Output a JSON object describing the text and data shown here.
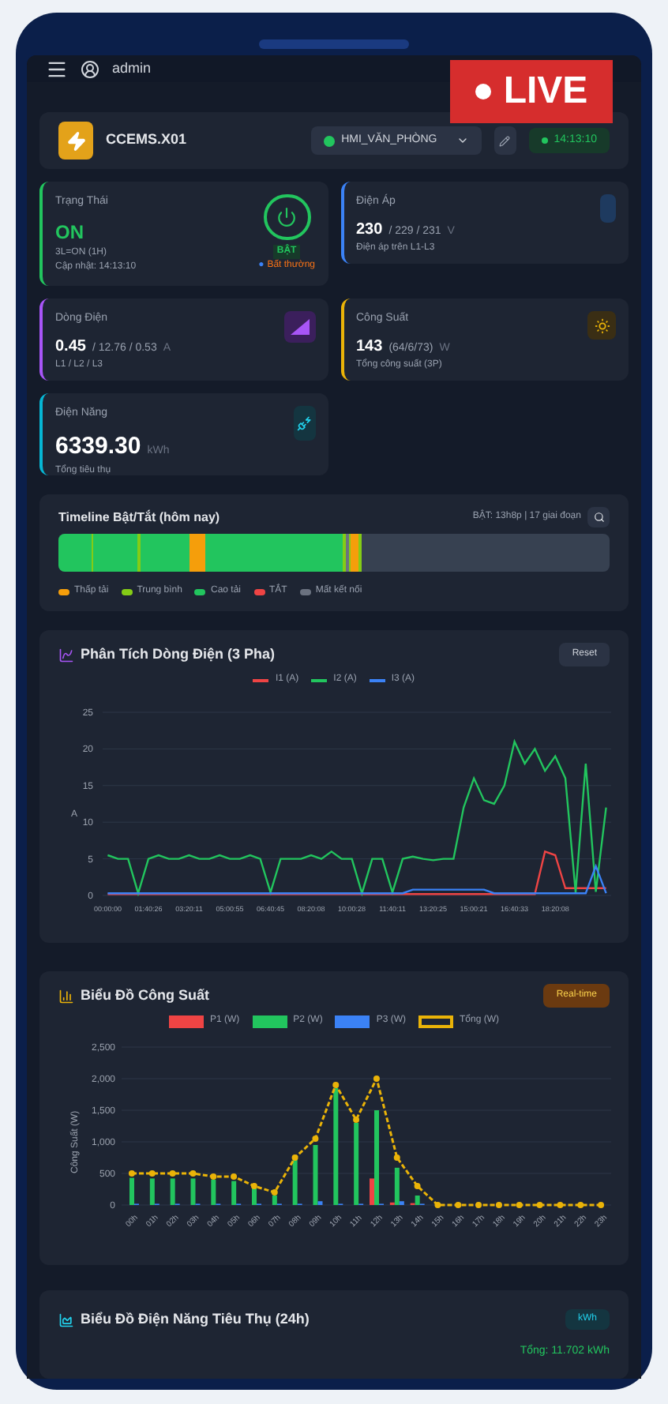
{
  "header": {
    "user": "admin"
  },
  "live_badge": {
    "label": "LIVE"
  },
  "device": {
    "name": "CCEMS.X01",
    "location": "HMI_VĂN_PHÒNG",
    "online": true,
    "time": "14:13:10"
  },
  "cards": [
    {
      "kind": "status",
      "title": "Trạng Thái",
      "value": "ON",
      "on": true,
      "note": "3L=ON (1H)",
      "note2": "Cập nhật: 14:13:10",
      "toggle": "BẬT",
      "alert_icon": "●",
      "alert": "Bất thường",
      "color": "#22c55e"
    },
    {
      "kind": "metric",
      "title": "Điện Áp",
      "value": "230",
      "rest": "/ 229 / 231",
      "unit": "V",
      "note": "Điện áp trên L1-L3",
      "color": "#3b82f6"
    },
    {
      "kind": "metric",
      "title": "Dòng Điện",
      "value": "0.45",
      "rest": "/ 12.76 / 0.53",
      "unit": "A",
      "note": "L1 / L2 / L3",
      "color": "#a855f7"
    },
    {
      "kind": "metric",
      "title": "Công Suất",
      "value": "143",
      "rest": "(64/6/73)",
      "unit": "W",
      "note": "Tổng công suất (3P)",
      "color": "#eab308"
    },
    {
      "kind": "energy",
      "title": "Điện Năng",
      "value": "6339.30",
      "unit": "kWh",
      "note": "Tổng tiêu thụ",
      "color": "#06b6d4"
    }
  ],
  "timeline": {
    "title": "Timeline Bật/Tắt (hôm nay)",
    "summary": "BẬT: 13h8p | 17 giai đoạn",
    "legend": [
      {
        "label": "Thấp tải",
        "color": "#f59e0b"
      },
      {
        "label": "Trung bình",
        "color": "#84cc16"
      },
      {
        "label": "Cao tải",
        "color": "#22c55e"
      },
      {
        "label": "TẮT",
        "color": "#ef4444"
      },
      {
        "label": "Mất kết nối",
        "color": "#6b7280"
      }
    ]
  },
  "current_chart": {
    "title": "Phân Tích Dòng Điện (3 Pha)",
    "button": "Reset",
    "chart_data": {
      "type": "line",
      "grid": true,
      "ylabel": "A",
      "ylim": [
        0,
        25
      ],
      "yticks": [
        0,
        5,
        10,
        15,
        20,
        25
      ],
      "categories": [
        "00:00:00",
        null,
        null,
        null,
        "01:40:26",
        null,
        null,
        null,
        "03:20:11",
        null,
        null,
        null,
        "05:00:55",
        null,
        null,
        null,
        "06:40:45",
        null,
        null,
        null,
        "08:20:08",
        null,
        null,
        null,
        "10:00:28",
        null,
        null,
        null,
        "11:40:11",
        null,
        null,
        null,
        "13:20:25",
        null,
        null,
        null,
        "15:00:21",
        null,
        null,
        null,
        "16:40:33",
        null,
        null,
        null,
        "18:20:08",
        null,
        null,
        null,
        null,
        null
      ],
      "series": [
        {
          "name": "I1 (A)",
          "color": "#ef4444",
          "values": [
            0.2,
            0.2,
            0.2,
            0.2,
            0.2,
            0.2,
            0.2,
            0.2,
            0.2,
            0.2,
            0.2,
            0.2,
            0.2,
            0.2,
            0.2,
            0.2,
            0.2,
            0.2,
            0.2,
            0.2,
            0.2,
            0.2,
            0.2,
            0.2,
            0.2,
            0.2,
            0.2,
            0.2,
            0.2,
            0.2,
            0.2,
            0.2,
            0.2,
            0.2,
            0.2,
            0.2,
            0.2,
            0.2,
            0.2,
            0.2,
            0.2,
            0.2,
            0.2,
            6,
            5.5,
            1,
            1,
            1,
            1,
            1
          ]
        },
        {
          "name": "I2 (A)",
          "color": "#22c55e",
          "values": [
            5.5,
            5,
            5,
            0.3,
            5,
            5.5,
            5,
            5,
            5.5,
            5,
            5,
            5.5,
            5,
            5,
            5.5,
            5,
            0.4,
            5,
            5,
            5,
            5.5,
            5,
            6,
            5,
            5,
            0.3,
            5,
            5,
            0.4,
            5,
            5.3,
            5,
            4.8,
            5,
            5,
            12,
            16,
            13,
            12.5,
            15,
            21,
            18,
            20,
            17,
            19,
            16,
            0.4,
            18,
            0.5,
            12
          ]
        },
        {
          "name": "I3 (A)",
          "color": "#3b82f6",
          "values": [
            0.3,
            0.3,
            0.3,
            0.3,
            0.3,
            0.3,
            0.3,
            0.3,
            0.3,
            0.3,
            0.3,
            0.3,
            0.3,
            0.3,
            0.3,
            0.3,
            0.3,
            0.3,
            0.3,
            0.3,
            0.3,
            0.3,
            0.3,
            0.3,
            0.3,
            0.3,
            0.3,
            0.3,
            0.3,
            0.3,
            0.8,
            0.8,
            0.8,
            0.8,
            0.8,
            0.8,
            0.8,
            0.8,
            0.3,
            0.3,
            0.3,
            0.3,
            0.3,
            0.3,
            0.3,
            0.3,
            0.3,
            0.3,
            4,
            0.3
          ]
        }
      ]
    }
  },
  "power_chart": {
    "title": "Biểu Đồ Công Suất",
    "button": "Real-time",
    "chart_data": {
      "type": "bar",
      "grid": true,
      "ylabel": "Công Suất (W)",
      "ylim": [
        0,
        2500
      ],
      "yticks": [
        {
          "value": 0,
          "label": "0"
        },
        {
          "value": 500,
          "label": "500"
        },
        {
          "value": 1000,
          "label": "1,000"
        },
        {
          "value": 1500,
          "label": "1,500"
        },
        {
          "value": 2000,
          "label": "2,000"
        },
        {
          "value": 2500,
          "label": "2,500"
        }
      ],
      "categories": [
        "00h",
        "01h",
        "02h",
        "03h",
        "04h",
        "05h",
        "06h",
        "07h",
        "08h",
        "09h",
        "10h",
        "11h",
        "12h",
        "13h",
        "14h",
        "15h",
        "16h",
        "17h",
        "18h",
        "19h",
        "20h",
        "21h",
        "22h",
        "23h"
      ],
      "series": [
        {
          "name": "P1 (W)",
          "color": "#ef4444",
          "values": [
            0,
            0,
            0,
            0,
            0,
            0,
            0,
            0,
            0,
            0,
            0,
            0,
            420,
            40,
            30,
            0,
            0,
            0,
            0,
            0,
            0,
            0,
            0,
            0
          ]
        },
        {
          "name": "P2 (W)",
          "color": "#22c55e",
          "values": [
            430,
            420,
            420,
            420,
            400,
            380,
            280,
            150,
            720,
            950,
            1850,
            1300,
            1500,
            590,
            150,
            0,
            0,
            0,
            0,
            0,
            0,
            0,
            0,
            0
          ]
        },
        {
          "name": "P3 (W)",
          "color": "#3b82f6",
          "values": [
            20,
            20,
            20,
            20,
            20,
            20,
            20,
            20,
            20,
            60,
            20,
            20,
            20,
            60,
            20,
            0,
            0,
            0,
            0,
            0,
            0,
            0,
            0,
            0
          ]
        },
        {
          "name": "Tổng (W)",
          "color": "#eab308",
          "type": "line",
          "line_style": "dashed",
          "marker": "circle",
          "values": [
            500,
            500,
            500,
            500,
            450,
            450,
            300,
            200,
            750,
            1050,
            1900,
            1350,
            2000,
            750,
            300,
            0,
            0,
            0,
            0,
            0,
            0,
            0,
            0,
            0
          ]
        }
      ]
    }
  },
  "energy_chart": {
    "title": "Biểu Đồ Điện Năng Tiêu Thụ (24h)",
    "badge": "kWh",
    "total": "Tổng: 11.702 kWh"
  }
}
